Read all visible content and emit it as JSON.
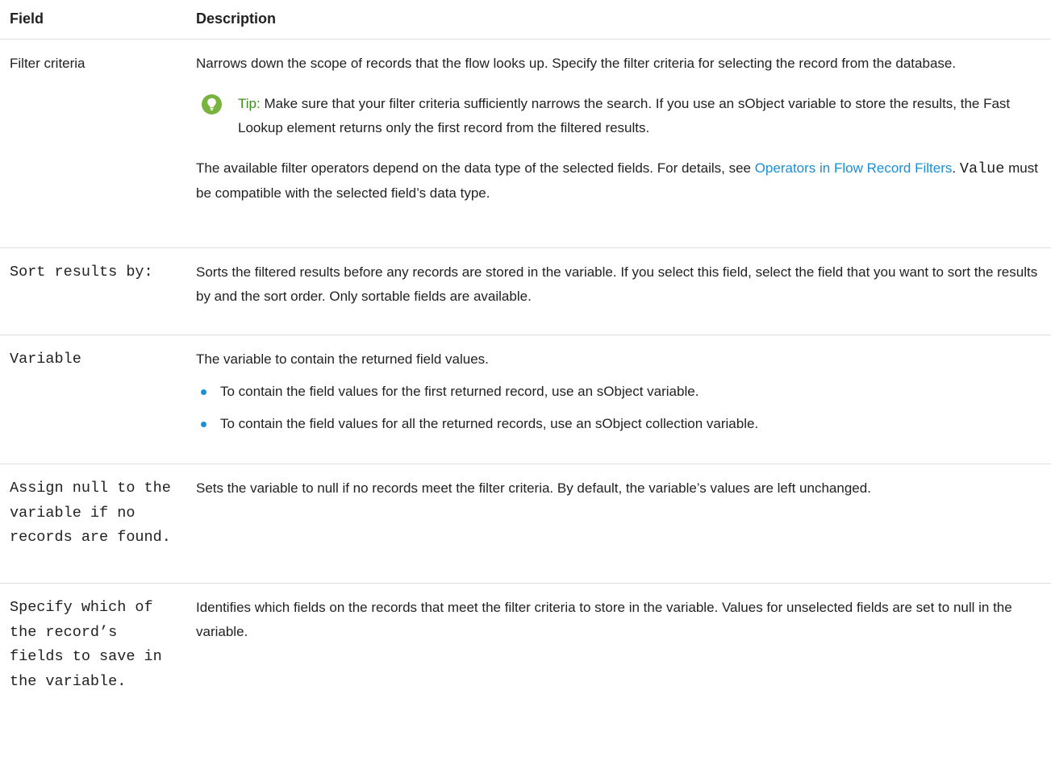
{
  "table": {
    "header": {
      "field": "Field",
      "description": "Description"
    },
    "rows": [
      {
        "field": "Filter criteria",
        "description": "Narrows down the scope of records that the flow looks up. Specify the filter criteria for selecting the record from the database.",
        "tip_label": "Tip:",
        "tip_text": "Make sure that your filter criteria sufficiently narrows the search. If you use an sObject variable to store the results, the Fast Lookup element returns only the first record from the filtered results.",
        "note_before_link": "The available filter operators depend on the data type of the selected fields. For details, see ",
        "link_text": "Operators in Flow Record Filters",
        "note_after_link": ".",
        "code_term": "Value",
        "note_end": " must be compatible with the selected field’s data type."
      },
      {
        "field": "Sort results by:",
        "description": "Sorts the filtered results before any records are stored in the variable. If you select this field, select the field that you want to sort the results by and the sort order. Only sortable fields are available."
      },
      {
        "field": "Variable",
        "description": "The variable to contain the returned field values.",
        "bullets": [
          "To contain the field values for the first returned record, use an sObject variable.",
          "To contain the field values for all the returned records, use an sObject collection variable."
        ]
      },
      {
        "field": "Assign null to the variable if no records are found.",
        "description": "Sets the variable to null if no records meet the filter criteria. By default, the variable’s values are left unchanged."
      },
      {
        "field": "Specify which of the record’s fields to save in the variable.",
        "description": "Identifies which fields on the records that meet the filter criteria to store in the variable. Values for unselected fields are set to null in the variable."
      }
    ]
  },
  "colors": {
    "link": "#1a8fd8",
    "tip_label": "#3f8c1f",
    "tip_icon": "#77b33e",
    "bullet": "#1a8fd8",
    "rule": "#dddddd"
  },
  "icons": {
    "tip": "lightbulb-icon",
    "bullet": "bullet-dot-icon"
  }
}
